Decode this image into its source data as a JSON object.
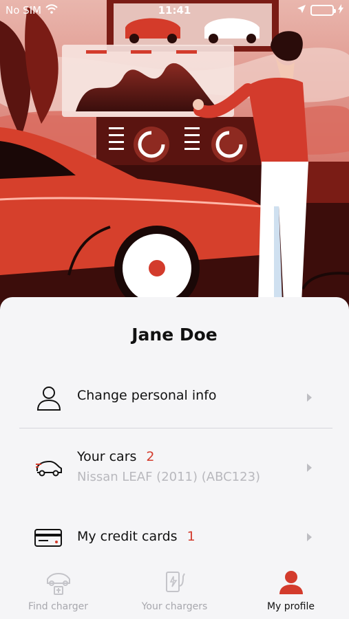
{
  "status_bar": {
    "carrier": "No SIM",
    "time": "11:41",
    "battery_level": 1.0
  },
  "profile": {
    "name": "Jane Doe"
  },
  "menu": {
    "personal": {
      "label": "Change personal info",
      "icon": "person-icon"
    },
    "cars": {
      "label": "Your cars",
      "count": "2",
      "subtitle": "Nissan LEAF (2011) (ABC123)",
      "icon": "car-icon"
    },
    "cards": {
      "label": "My credit cards",
      "count": "1",
      "icon": "credit-card-icon"
    }
  },
  "tabs": [
    {
      "label": "Find charger",
      "icon": "find-charger-icon",
      "active": false
    },
    {
      "label": "Your chargers",
      "icon": "charger-icon",
      "active": false
    },
    {
      "label": "My profile",
      "icon": "profile-icon",
      "active": true
    }
  ],
  "colors": {
    "accent": "#d33b2c",
    "inactive": "#a7a7ad",
    "text": "#111111"
  }
}
